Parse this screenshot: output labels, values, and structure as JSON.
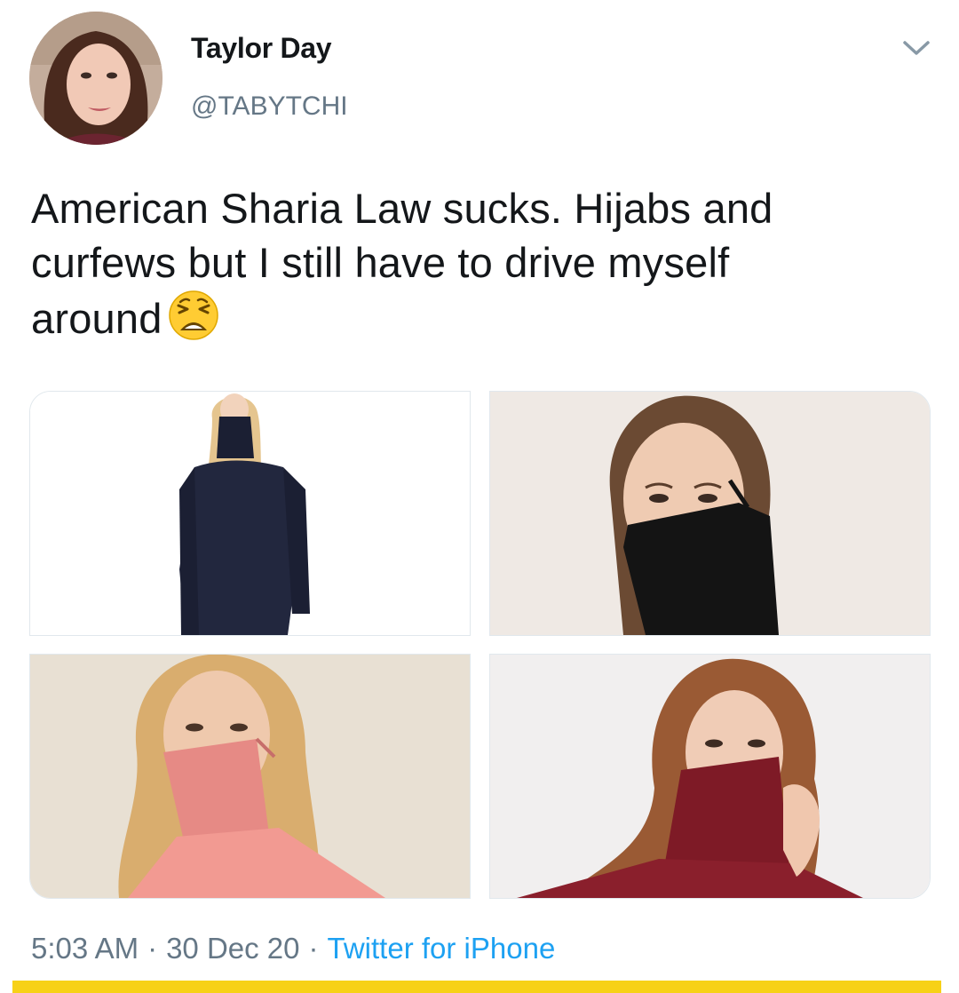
{
  "tweet": {
    "author": {
      "display_name": "Taylor Day",
      "handle": "@TABYTCHI",
      "avatar_icon": "profile-photo"
    },
    "more_icon": "chevron-down-icon",
    "text_lines": [
      "American Sharia Law sucks. Hijabs and",
      "curfews but I still have to drive myself",
      "around"
    ],
    "emoji": "weary-face-emoji",
    "media": [
      {
        "description_icon": "photo-navy-sweater-with-face-covering"
      },
      {
        "description_icon": "photo-black-face-covering"
      },
      {
        "description_icon": "photo-pink-turtleneck-face-covering"
      },
      {
        "description_icon": "photo-burgundy-turtleneck-face-covering"
      }
    ],
    "time": "5:03 AM",
    "date": "30 Dec 20",
    "source": "Twitter for iPhone",
    "separator": "·"
  },
  "colors": {
    "text_primary": "#14171a",
    "text_secondary": "#657786",
    "link": "#1da1f2",
    "accent_bar": "#f7d117"
  }
}
